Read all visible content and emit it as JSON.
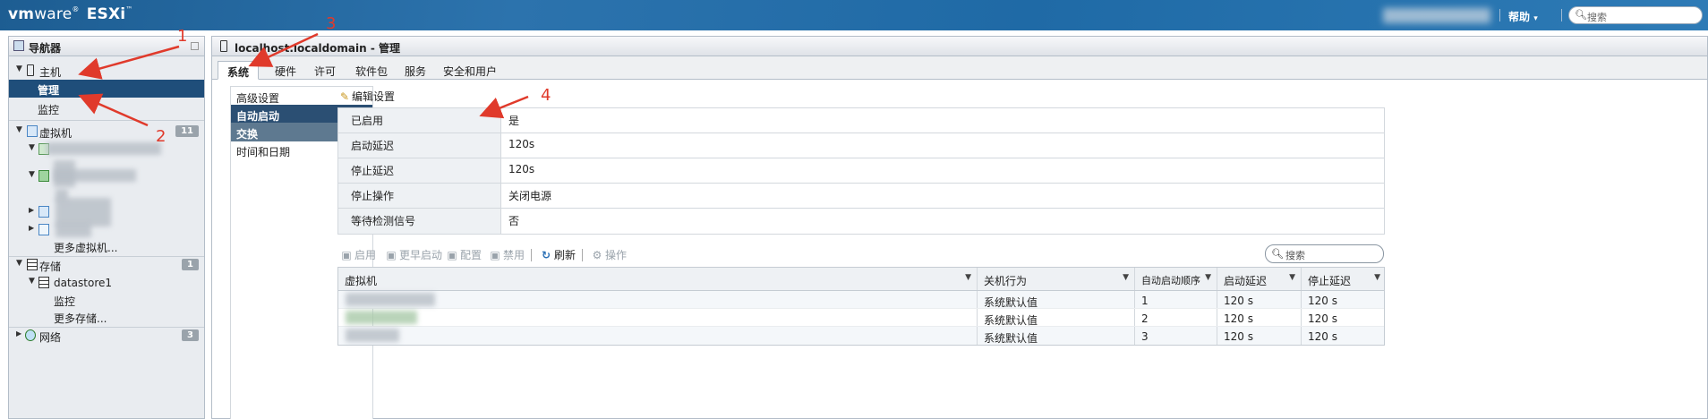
{
  "topbar": {
    "brand_vm": "vm",
    "brand_ware": "ware",
    "brand_reg": "®",
    "brand_product": "ESXi",
    "brand_tm": "™",
    "help_label": "帮助",
    "help_caret": "▾",
    "search_placeholder": "搜索",
    "search_icon": "search-icon"
  },
  "navigator": {
    "title": "导航器",
    "host": {
      "label": "主机",
      "children": [
        {
          "label": "管理",
          "selected": true
        },
        {
          "label": "监控"
        }
      ]
    },
    "vms": {
      "label": "虚拟机",
      "count": "11",
      "more_label": "更多虚拟机..."
    },
    "storage": {
      "label": "存储",
      "count": "1",
      "datastore": "datastore1",
      "monitor": "监控",
      "more_label": "更多存储..."
    },
    "network": {
      "label": "网络",
      "count": "3"
    }
  },
  "main": {
    "title": "localhost.localdomain - 管理",
    "tabs": [
      "系统",
      "硬件",
      "许可",
      "软件包",
      "服务",
      "安全和用户"
    ],
    "active_tab": "系统",
    "subnav": [
      "高级设置",
      "自动启动",
      "交换",
      "时间和日期"
    ],
    "edit_settings": "编辑设置",
    "autostart": [
      {
        "key": "已启用",
        "value": "是"
      },
      {
        "key": "启动延迟",
        "value": "120s"
      },
      {
        "key": "停止延迟",
        "value": "120s"
      },
      {
        "key": "停止操作",
        "value": "关闭电源"
      },
      {
        "key": "等待检测信号",
        "value": "否"
      }
    ],
    "toolbar": {
      "enable": "启用",
      "start_earlier": "更早启动",
      "configure": "配置",
      "disable": "禁用",
      "refresh": "刷新",
      "actions": "操作",
      "search_placeholder": "搜索"
    },
    "grid": {
      "columns": [
        "虚拟机",
        "关机行为",
        "自动启动顺序",
        "启动延迟",
        "停止延迟"
      ],
      "rows": [
        {
          "vm": "",
          "shutdown": "系统默认值",
          "order": "1",
          "start_delay": "120 s",
          "stop_delay": "120 s"
        },
        {
          "vm": "",
          "shutdown": "系统默认值",
          "order": "2",
          "start_delay": "120 s",
          "stop_delay": "120 s"
        },
        {
          "vm": "",
          "shutdown": "系统默认值",
          "order": "3",
          "start_delay": "120 s",
          "stop_delay": "120 s"
        }
      ]
    }
  },
  "annotations": [
    "1",
    "2",
    "3",
    "4"
  ],
  "colors": {
    "accent": "#1f4e7a",
    "annotation": "#e03a2b",
    "topbar": "#2c73ad"
  }
}
